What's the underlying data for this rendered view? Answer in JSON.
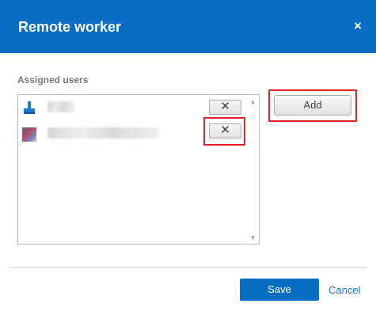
{
  "dialog": {
    "title": "Remote worker",
    "close_glyph": "×",
    "header_color": "#0a6dc4"
  },
  "assigned_users": {
    "label": "Assigned users",
    "items": [
      {
        "avatar": "user-placeholder-icon",
        "name_redacted": true,
        "remove_glyph": "✕"
      },
      {
        "avatar": "user-photo",
        "name_redacted": true,
        "remove_glyph": "✕"
      }
    ],
    "scroll_up_glyph": "▲",
    "scroll_down_glyph": "▼"
  },
  "actions": {
    "add_label": "Add",
    "save_label": "Save",
    "cancel_label": "Cancel"
  },
  "annotations": {
    "highlight_color": "#e2232a"
  }
}
